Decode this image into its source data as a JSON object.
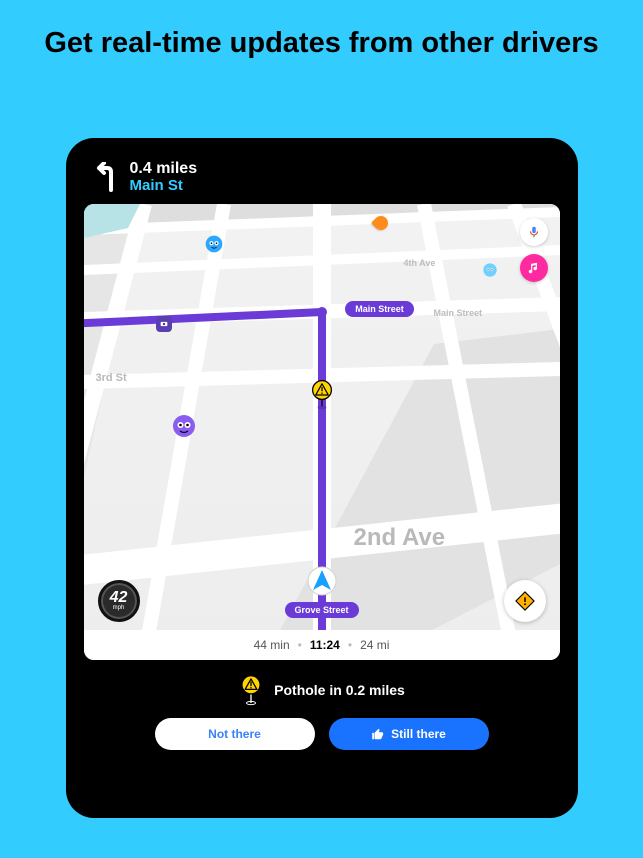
{
  "promo": {
    "headline": "Get real-time updates from other drivers"
  },
  "nav": {
    "distance": "0.4 miles",
    "road": "Main St"
  },
  "map": {
    "labels": {
      "second_ave": "2nd Ave",
      "third_st": "3rd St",
      "fourth_ave": "4th Ave",
      "main_st_small": "Main Street",
      "main_pill": "Main Street",
      "grove_pill": "Grove Street"
    },
    "speed": {
      "value": "42",
      "unit": "mph"
    }
  },
  "eta": {
    "duration": "44 min",
    "arrival": "11:24",
    "distance": "24 mi"
  },
  "alert": {
    "text": "Pothole in 0.2 miles",
    "not_there": "Not there",
    "still_there": "Still there"
  }
}
